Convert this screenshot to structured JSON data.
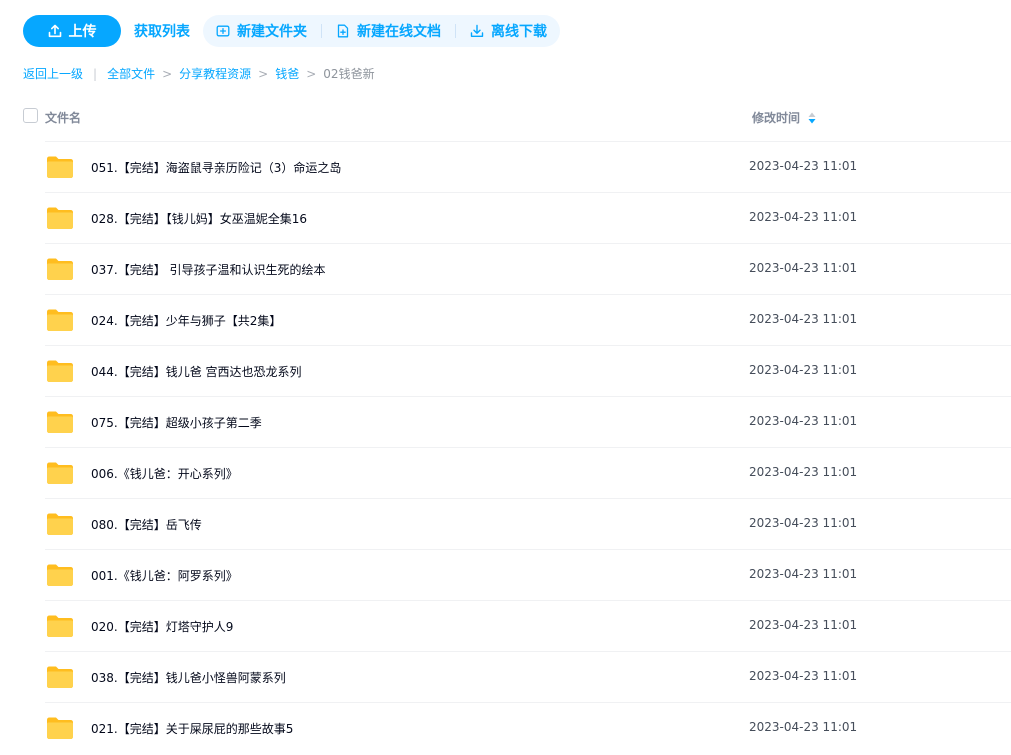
{
  "toolbar": {
    "upload_label": "上传",
    "fetch_list_label": "获取列表",
    "new_folder_label": "新建文件夹",
    "new_online_doc_label": "新建在线文档",
    "offline_download_label": "离线下载"
  },
  "breadcrumb": {
    "back": "返回上一级",
    "all_files": "全部文件",
    "level1": "分享教程资源",
    "level2": "钱爸",
    "current": "02钱爸新"
  },
  "header": {
    "name_col": "文件名",
    "time_col": "修改时间"
  },
  "files": [
    {
      "name": "051.【完结】海盗鼠寻亲历险记（3）命运之岛",
      "time": "2023-04-23 11:01"
    },
    {
      "name": "028.【完结】【钱儿妈】女巫温妮全集16",
      "time": "2023-04-23 11:01"
    },
    {
      "name": "037.【完结】 引导孩子温和认识生死的绘本",
      "time": "2023-04-23 11:01"
    },
    {
      "name": "024.【完结】少年与狮子【共2集】",
      "time": "2023-04-23 11:01"
    },
    {
      "name": "044.【完结】钱儿爸 宫西达也恐龙系列",
      "time": "2023-04-23 11:01"
    },
    {
      "name": "075.【完结】超级小孩子第二季",
      "time": "2023-04-23 11:01"
    },
    {
      "name": "006.《钱儿爸：开心系列》",
      "time": "2023-04-23 11:01"
    },
    {
      "name": "080.【完结】岳飞传",
      "time": "2023-04-23 11:01"
    },
    {
      "name": "001.《钱儿爸：阿罗系列》",
      "time": "2023-04-23 11:01"
    },
    {
      "name": "020.【完结】灯塔守护人9",
      "time": "2023-04-23 11:01"
    },
    {
      "name": "038.【完结】钱儿爸小怪兽阿蒙系列",
      "time": "2023-04-23 11:01"
    },
    {
      "name": "021.【完结】关于屎尿屁的那些故事5",
      "time": "2023-04-23 11:01"
    }
  ],
  "colors": {
    "accent": "#06a7ff",
    "folder": "#ffc933"
  }
}
